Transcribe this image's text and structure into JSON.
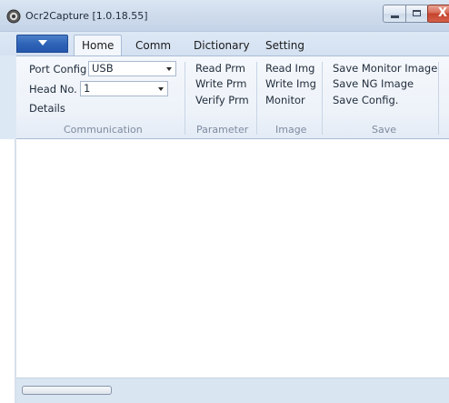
{
  "window": {
    "title": "Ocr2Capture [1.0.18.55]",
    "close_glyph": "X"
  },
  "tabs": [
    {
      "label": "Home",
      "active": true
    },
    {
      "label": "Comm",
      "active": false
    },
    {
      "label": "Dictionary",
      "active": false
    },
    {
      "label": "Setting",
      "active": false
    }
  ],
  "ribbon": {
    "communication": {
      "port_config_label": "Port Config",
      "port_config_value": "USB",
      "head_no_label": "Head No.",
      "head_no_value": "1",
      "details_label": "Details",
      "caption": "Communication"
    },
    "parameter": {
      "read": "Read Prm",
      "write": "Write Prm",
      "verify": "Verify Prm",
      "caption": "Parameter"
    },
    "image": {
      "read": "Read Img",
      "write": "Write Img",
      "monitor": "Monitor",
      "caption": "Image"
    },
    "save": {
      "monitor_image": "Save Monitor Image",
      "ng_image": "Save NG Image",
      "config": "Save Config.",
      "caption": "Save"
    }
  },
  "colors": {
    "accent": "#2f64b8",
    "close": "#c5422b"
  },
  "icons": {
    "app": "app-logo-icon",
    "minimize": "minimize-icon",
    "maximize": "maximize-icon",
    "close": "close-icon",
    "app_menu": "chevron-down-icon"
  }
}
